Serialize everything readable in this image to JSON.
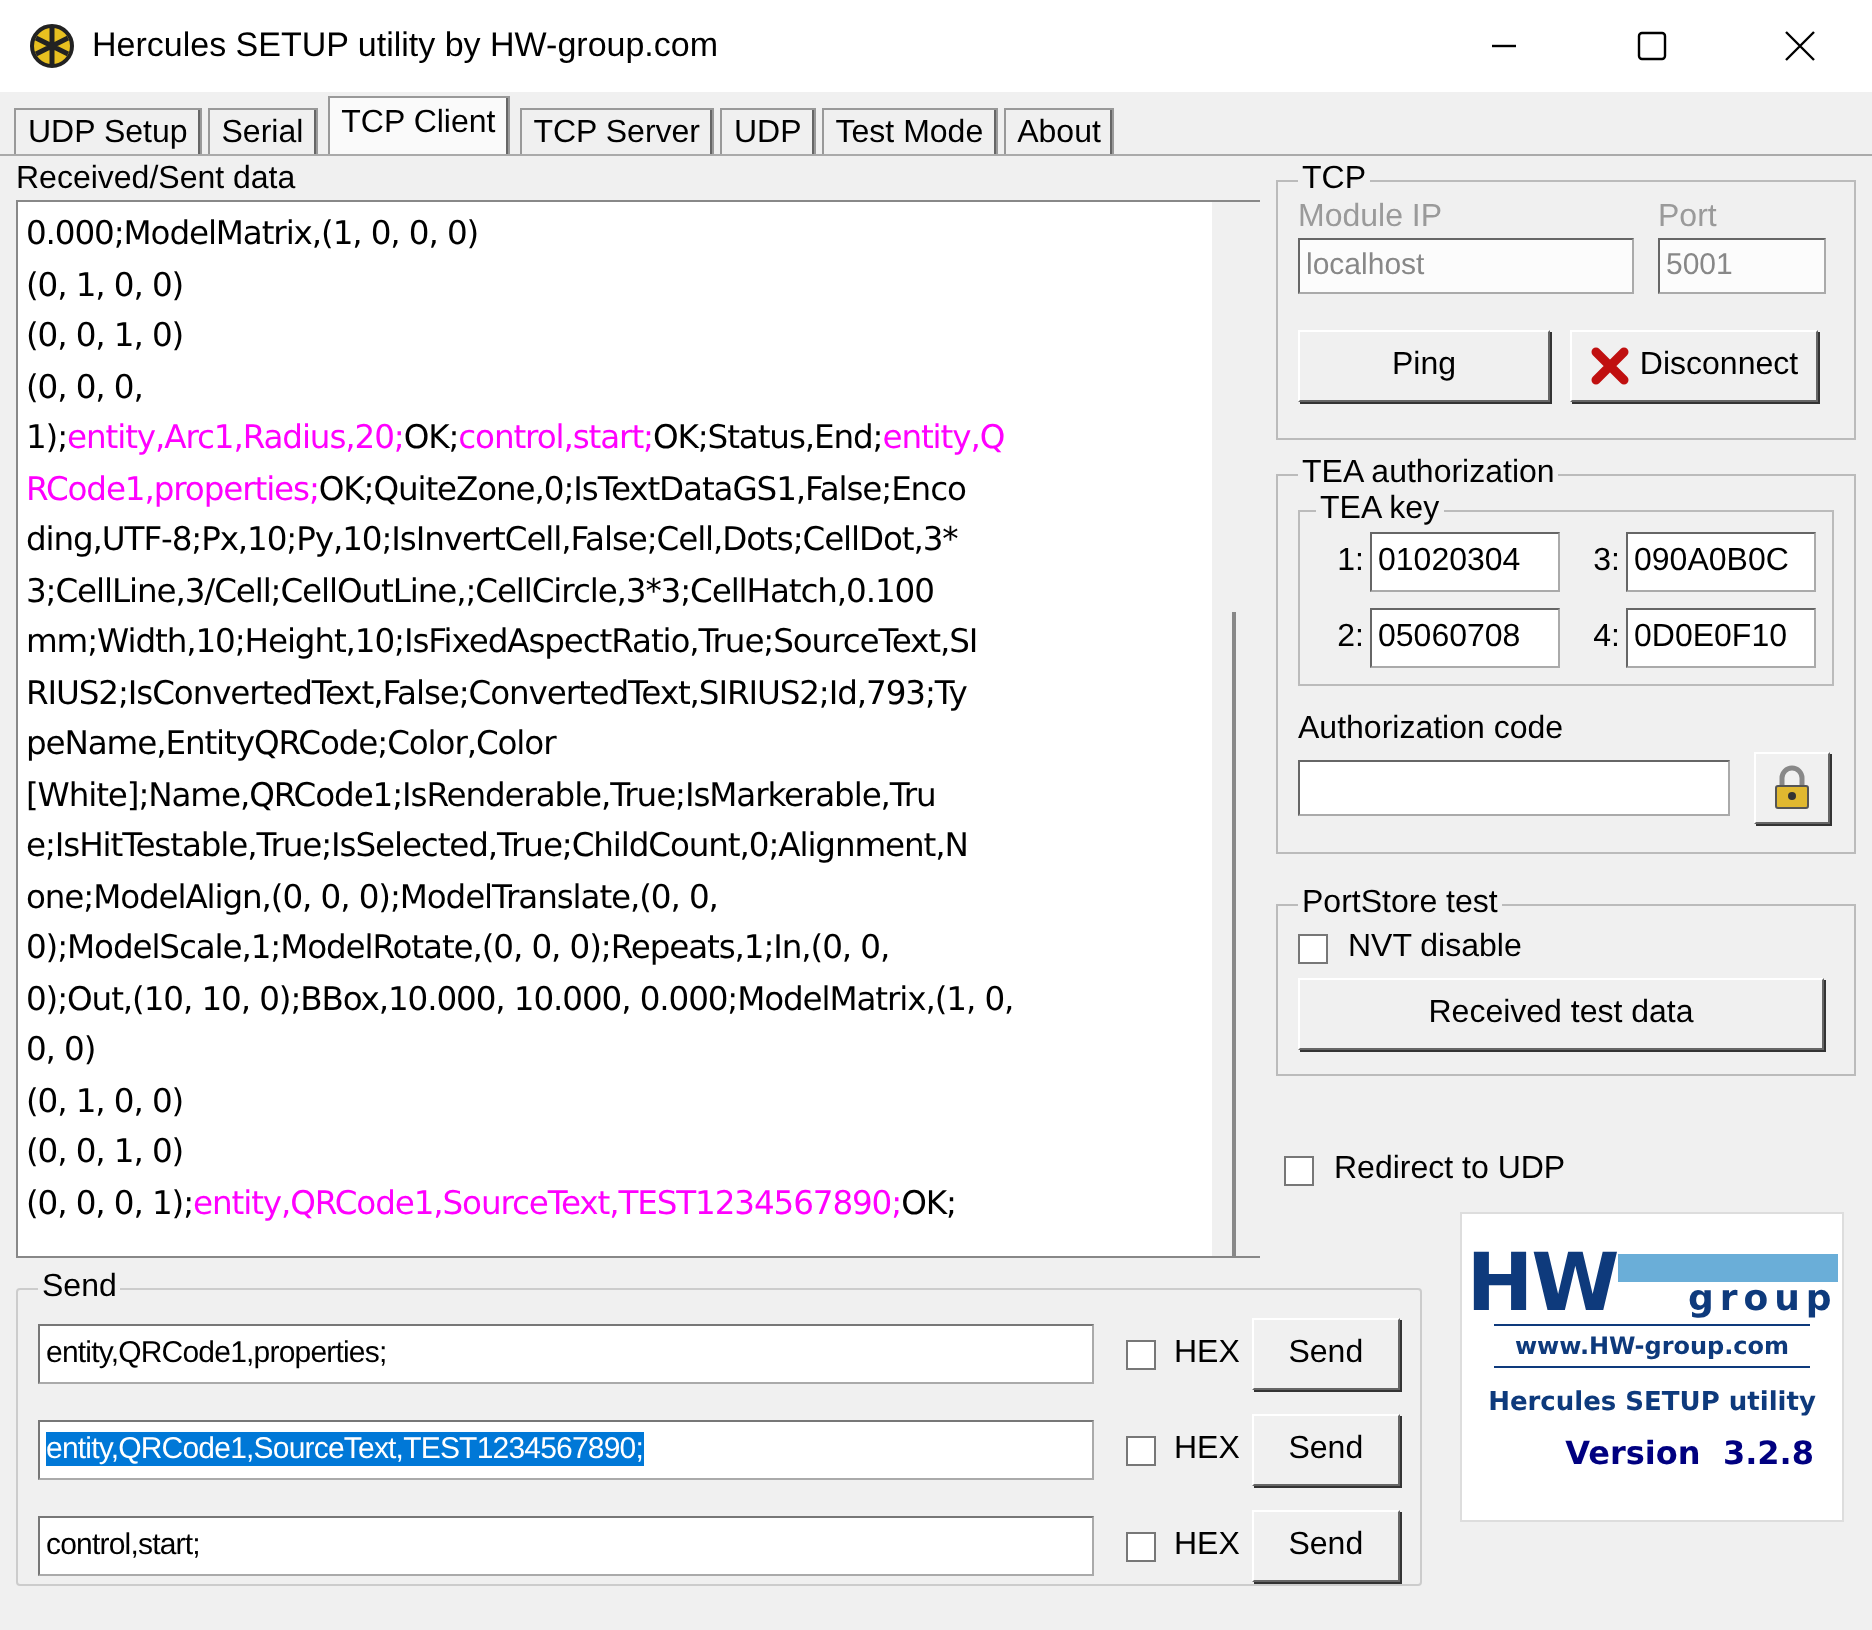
{
  "window": {
    "title": "Hercules SETUP utility by HW-group.com"
  },
  "tabs": [
    {
      "label": "UDP Setup",
      "selected": false
    },
    {
      "label": "Serial",
      "selected": false
    },
    {
      "label": "TCP Client",
      "selected": true
    },
    {
      "label": "TCP Server",
      "selected": false
    },
    {
      "label": "UDP",
      "selected": false
    },
    {
      "label": "Test Mode",
      "selected": false
    },
    {
      "label": "About",
      "selected": false
    }
  ],
  "received": {
    "label": "Received/Sent data",
    "lines": [
      [
        {
          "text": "0.000;ModelMatrix,(1, 0, 0, 0)",
          "kind": "received"
        }
      ],
      [
        {
          "text": "(0, 1, 0, 0)",
          "kind": "received"
        }
      ],
      [
        {
          "text": "(0, 0, 1, 0)",
          "kind": "received"
        }
      ],
      [
        {
          "text": "(0, 0, 0,",
          "kind": "received"
        }
      ],
      [
        {
          "text": "1);",
          "kind": "received"
        },
        {
          "text": "entity,Arc1,Radius,20;",
          "kind": "sent"
        },
        {
          "text": "OK;",
          "kind": "received"
        },
        {
          "text": "control,start;",
          "kind": "sent"
        },
        {
          "text": "OK;Status,End;",
          "kind": "received"
        },
        {
          "text": "entity,Q",
          "kind": "sent"
        }
      ],
      [
        {
          "text": "RCode1,properties;",
          "kind": "sent"
        },
        {
          "text": "OK;QuiteZone,0;IsTextDataGS1,False;Enco",
          "kind": "received"
        }
      ],
      [
        {
          "text": "ding,UTF-8;Px,10;Py,10;IsInvertCell,False;Cell,Dots;CellDot,3*",
          "kind": "received"
        }
      ],
      [
        {
          "text": "3;CellLine,3/Cell;CellOutLine,;CellCircle,3*3;CellHatch,0.100",
          "kind": "received"
        }
      ],
      [
        {
          "text": "mm;Width,10;Height,10;IsFixedAspectRatio,True;SourceText,SI",
          "kind": "received"
        }
      ],
      [
        {
          "text": "RIUS2;IsConvertedText,False;ConvertedText,SIRIUS2;Id,793;Ty",
          "kind": "received"
        }
      ],
      [
        {
          "text": "peName,EntityQRCode;Color,Color",
          "kind": "received"
        }
      ],
      [
        {
          "text": "[White];Name,QRCode1;IsRenderable,True;IsMarkerable,Tru",
          "kind": "received"
        }
      ],
      [
        {
          "text": "e;IsHitTestable,True;IsSelected,True;ChildCount,0;Alignment,N",
          "kind": "received"
        }
      ],
      [
        {
          "text": "one;ModelAlign,(0, 0, 0);ModelTranslate,(0, 0,",
          "kind": "received"
        }
      ],
      [
        {
          "text": "0);ModelScale,1;ModelRotate,(0, 0, 0);Repeats,1;In,(0, 0,",
          "kind": "received"
        }
      ],
      [
        {
          "text": "0);Out,(10, 10, 0);BBox,10.000, 10.000, 0.000;ModelMatrix,(1, 0,",
          "kind": "received"
        }
      ],
      [
        {
          "text": "0, 0)",
          "kind": "received"
        }
      ],
      [
        {
          "text": "(0, 1, 0, 0)",
          "kind": "received"
        }
      ],
      [
        {
          "text": "(0, 0, 1, 0)",
          "kind": "received"
        }
      ],
      [
        {
          "text": "(0, 0, 0, 1);",
          "kind": "received"
        },
        {
          "text": "entity,QRCode1,SourceText,TEST1234567890;",
          "kind": "sent"
        },
        {
          "text": "OK;",
          "kind": "received"
        }
      ]
    ]
  },
  "tcp": {
    "title": "TCP",
    "module_ip_label": "Module IP",
    "module_ip": "localhost",
    "port_label": "Port",
    "port": "5001",
    "disabled": true,
    "ping": "Ping",
    "disconnect": "Disconnect"
  },
  "tea": {
    "title": "TEA authorization",
    "key_title": "TEA key",
    "keys": [
      {
        "index": "1:",
        "value": "01020304"
      },
      {
        "index": "3:",
        "value": "090A0B0C"
      },
      {
        "index": "2:",
        "value": "05060708"
      },
      {
        "index": "4:",
        "value": "0D0E0F10"
      }
    ],
    "auth_label": "Authorization code"
  },
  "portstore": {
    "title": "PortStore test",
    "nvt": {
      "label": "NVT disable",
      "checked": false
    },
    "button": "Received test data"
  },
  "redirect": {
    "label": "Redirect to UDP",
    "checked": false
  },
  "send": {
    "title": "Send",
    "rows": [
      {
        "value": "entity,QRCode1,properties;",
        "selected": false,
        "hex": {
          "label": "HEX",
          "checked": false
        },
        "button": "Send"
      },
      {
        "value": "entity,QRCode1,SourceText,TEST1234567890;",
        "selected": true,
        "hex": {
          "label": "HEX",
          "checked": false
        },
        "button": "Send"
      },
      {
        "value": "control,start;",
        "selected": false,
        "hex": {
          "label": "HEX",
          "checked": false
        },
        "button": "Send"
      }
    ]
  },
  "logo": {
    "mark": "HW",
    "group": "group",
    "url": "www.HW-group.com",
    "product": "Hercules SETUP utility",
    "version": "Version  3.2.8"
  }
}
